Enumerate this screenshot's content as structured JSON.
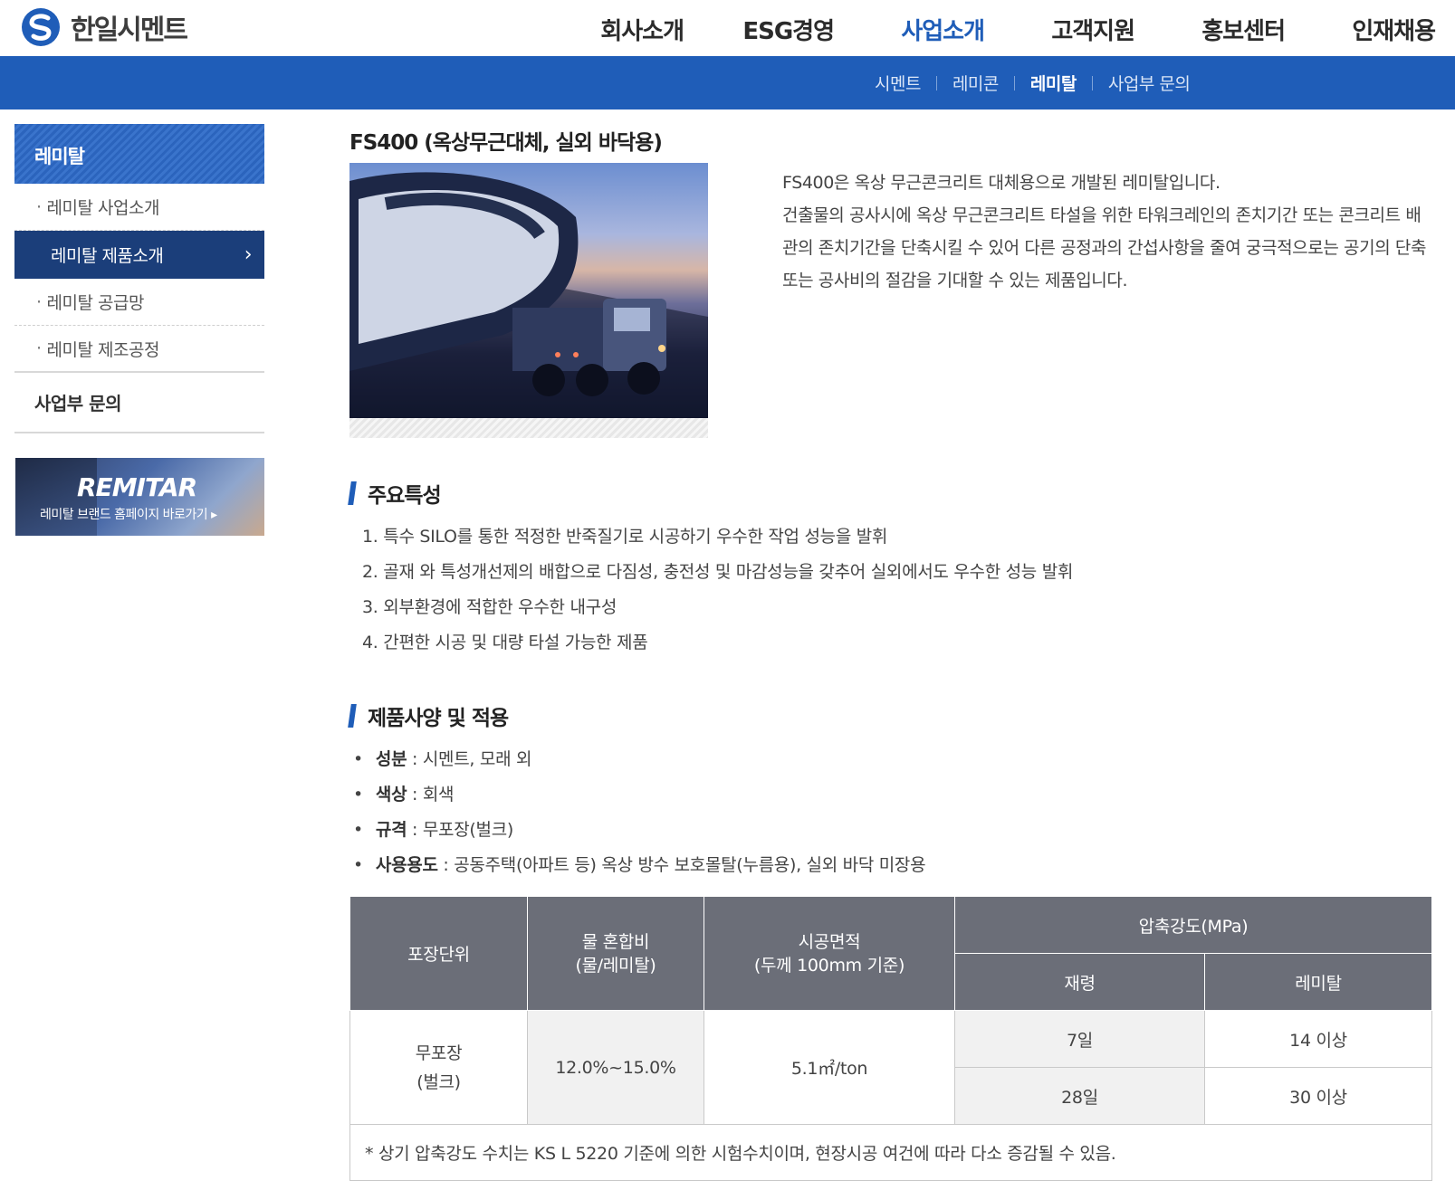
{
  "header": {
    "logo_text": "한일시멘트",
    "gnb": [
      "회사소개",
      "ESG경영",
      "사업소개",
      "고객지원",
      "홍보센터",
      "인재채용"
    ],
    "gnb_active_index": 2
  },
  "lnb": {
    "items": [
      "시멘트",
      "레미콘",
      "레미탈",
      "사업부 문의"
    ],
    "active_index": 2
  },
  "sidebar": {
    "title": "레미탈",
    "items": [
      {
        "label": "레미탈 사업소개",
        "active": false
      },
      {
        "label": "레미탈 제품소개",
        "active": true
      },
      {
        "label": "레미탈 공급망",
        "active": false
      },
      {
        "label": "레미탈 제조공정",
        "active": false
      }
    ],
    "group_label": "사업부 문의",
    "banner_title": "REMITAR",
    "banner_sub": "레미탈 브랜드 홈페이지 바로가기 ▸"
  },
  "product": {
    "title": "FS400 (옥상무근대체, 실외 바닥용)",
    "desc": "FS400은 옥상 무근콘크리트 대체용으로 개발된 레미탈입니다.\n건출물의 공사시에 옥상 무근콘크리트 타설을 위한 타워크레인의 존치기간 또는 콘크리트 배관의 존치기간을 단축시킬 수 있어 다른 공정과의 간섭사항을 줄여 궁극적으로는 공기의 단축 또는 공사비의 절감을 기대할 수 있는 제품입니다."
  },
  "features": {
    "heading": "주요특성",
    "items": [
      "1. 특수 SILO를 통한 적정한 반죽질기로 시공하기 우수한 작업 성능을 발휘",
      "2. 골재 와 특성개선제의 배합으로 다짐성, 충전성 및 마감성능을 갖추어 실외에서도 우수한 성능 발휘",
      "3. 외부환경에 적합한 우수한 내구성",
      "4. 간편한 시공 및 대량 타설 가능한 제품"
    ]
  },
  "specs": {
    "heading": "제품사양 및 적용",
    "items": [
      {
        "label": "성분",
        "value": " : 시멘트, 모래 외"
      },
      {
        "label": "색상",
        "value": " : 회색"
      },
      {
        "label": "규격",
        "value": " : 무포장(벌크)"
      },
      {
        "label": "사용용도",
        "value": " : 공동주택(아파트 등) 옥상 방수 보호몰탈(누름용), 실외 바닥 미장용"
      }
    ]
  },
  "table": {
    "h_pack": "포장단위",
    "h_water_1": "물 혼합비",
    "h_water_2": "(물/레미탈)",
    "h_area_1": "시공면적",
    "h_area_2": "(두께 100mm 기준)",
    "h_strength": "압축강도(MPa)",
    "h_age": "재령",
    "h_remitar": "레미탈",
    "pack_1": "무포장",
    "pack_2": "(벌크)",
    "water": "12.0%~15.0%",
    "area": "5.1㎡/ton",
    "rows": [
      {
        "age": "7일",
        "value": "14 이상"
      },
      {
        "age": "28일",
        "value": "30 이상"
      }
    ],
    "note": "* 상기 압축강도 수치는 KS L 5220 기준에 의한 시험수치이며, 현장시공 여건에 따라 다소 증감될 수 있음."
  }
}
